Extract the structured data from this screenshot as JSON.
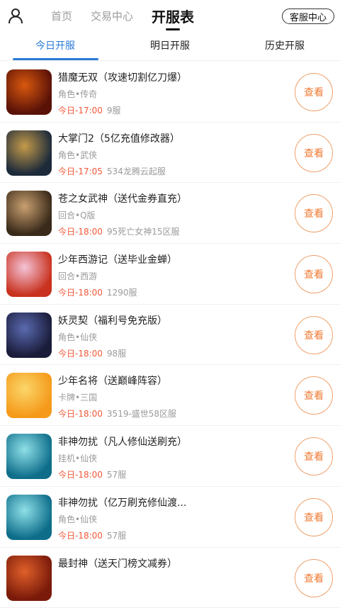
{
  "header": {
    "home_label": "首页",
    "trade_label": "交易中心",
    "title": "开服表",
    "service_label": "客服中心"
  },
  "tabs": [
    {
      "label": "今日开服",
      "active": true
    },
    {
      "label": "明日开服",
      "active": false
    },
    {
      "label": "历史开服",
      "active": false
    }
  ],
  "button_label": "查看",
  "accent_colors": {
    "blue": "#2a7bd8",
    "orange": "#f07a32",
    "red": "#f25a3a"
  },
  "games": [
    {
      "title": "猎魔无双（攻速切割亿刀爆）",
      "category": "角色•传奇",
      "time": "今日-17:00",
      "server": "9服",
      "thumb_colors": [
        "#5a1208",
        "#d9580e"
      ],
      "icon": "game-icon-liemo"
    },
    {
      "title": "大掌门2（5亿充值修改器）",
      "category": "角色•武侠",
      "time": "今日-17:05",
      "server": "534龙腾云起服",
      "thumb_colors": [
        "#1c2a3a",
        "#c49a4a"
      ],
      "icon": "game-icon-dazhangmen"
    },
    {
      "title": "苍之女武神（送代金券直充）",
      "category": "回合•Q版",
      "time": "今日-18:00",
      "server": "95死亡女神15区服",
      "thumb_colors": [
        "#3a2a1a",
        "#c9a070"
      ],
      "icon": "game-icon-cangzhi"
    },
    {
      "title": "少年西游记（送毕业金蝉）",
      "category": "回合•西游",
      "time": "今日-18:00",
      "server": "1290服",
      "thumb_colors": [
        "#c8321e",
        "#f4c4d8"
      ],
      "icon": "game-icon-xiyouji"
    },
    {
      "title": "妖灵契（福利号免充版）",
      "category": "角色•仙侠",
      "time": "今日-18:00",
      "server": "98服",
      "thumb_colors": [
        "#1a1c3a",
        "#5a6ab0"
      ],
      "icon": "game-icon-yaoling"
    },
    {
      "title": "少年名将（送巅峰阵容）",
      "category": "卡牌•三国",
      "time": "今日-18:00",
      "server": "3519-盛世58区服",
      "thumb_colors": [
        "#f59a1a",
        "#fbd66a"
      ],
      "icon": "game-icon-mingjiang"
    },
    {
      "title": "非神勿扰（凡人修仙送刷充）",
      "category": "挂机•仙侠",
      "time": "今日-18:00",
      "server": "57服",
      "thumb_colors": [
        "#0e6e8a",
        "#8fe0e8"
      ],
      "icon": "game-icon-feishen"
    },
    {
      "title": "非神勿扰（亿万刷充修仙渡...",
      "category": "角色•仙侠",
      "time": "今日-18:00",
      "server": "57服",
      "thumb_colors": [
        "#0e6e8a",
        "#8fe0e8"
      ],
      "icon": "game-icon-feishen"
    },
    {
      "title": "最封神（送天门榜文减券）",
      "category": "",
      "time": "",
      "server": "",
      "thumb_colors": [
        "#7a1a0a",
        "#e0602a"
      ],
      "icon": "game-icon-fengshen"
    }
  ]
}
